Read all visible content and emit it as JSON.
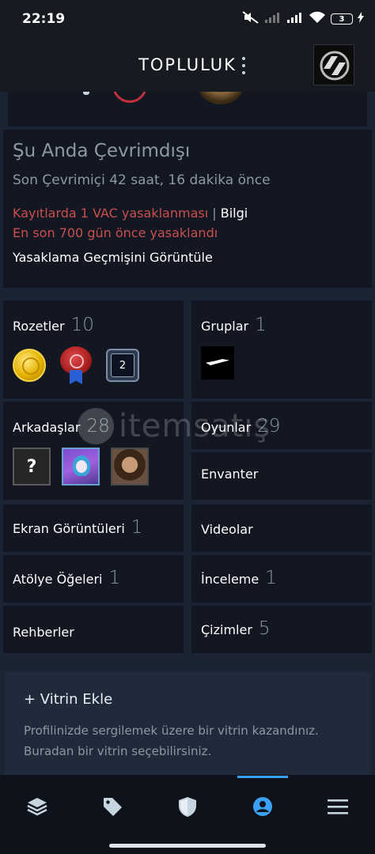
{
  "status_bar": {
    "time": "22:19",
    "battery": "3",
    "icons": [
      "mute-icon",
      "signal-icon",
      "signal-icon",
      "wifi-icon",
      "battery-icon",
      "charging-icon"
    ]
  },
  "header": {
    "title": "TOPLULUK"
  },
  "profile_status": {
    "state": "Şu Anda Çevrimdışı",
    "last_online": "Son Çevrimiçi 42 saat, 16 dakika önce",
    "vac_ban": "Kayıtlarda 1 VAC yasaklanması",
    "separator": "|",
    "info_link": "Bilgi",
    "last_ban": "En son 700 gün önce yasaklandı",
    "ban_history_link": "Yasaklama Geçmişini Görüntüle"
  },
  "stats": {
    "badges": {
      "label": "Rozetler",
      "count": "10",
      "level_badge": "2"
    },
    "groups": {
      "label": "Gruplar",
      "count": "1"
    },
    "friends": {
      "label": "Arkadaşlar",
      "count": "28",
      "unknown_avatar": "?"
    },
    "games": {
      "label": "Oyunlar",
      "count": "29"
    },
    "inventory": {
      "label": "Envanter"
    },
    "screenshots": {
      "label": "Ekran Görüntüleri",
      "count": "1"
    },
    "videos": {
      "label": "Videolar"
    },
    "workshop": {
      "label": "Atölye Öğeleri",
      "count": "1"
    },
    "reviews": {
      "label": "İnceleme",
      "count": "1"
    },
    "guides": {
      "label": "Rehberler"
    },
    "artwork": {
      "label": "Çizimler",
      "count": "5"
    }
  },
  "watermark": {
    "text": "itemsatış"
  },
  "showcase": {
    "add_label": "+ Vitrin Ekle",
    "description": "Profilinizde sergilemek üzere bir vitrin kazandınız. Buradan bir vitrin seçebilirsiniz."
  },
  "bottom_nav": {
    "items": [
      "library-icon",
      "store-tag-icon",
      "shield-icon",
      "profile-icon",
      "menu-icon"
    ],
    "active": "profile-icon",
    "accent": "#3aa0f2"
  },
  "colors": {
    "background": "#1b2433",
    "panel": "#121722",
    "ban_red": "#c94f4f",
    "muted": "#8f98a0"
  }
}
